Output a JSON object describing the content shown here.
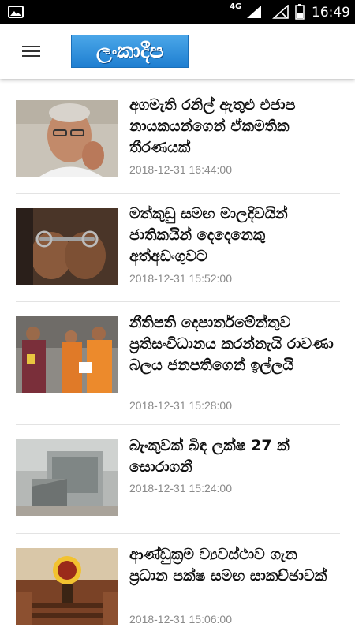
{
  "status_bar": {
    "network": "4G",
    "time": "16:49",
    "icons": [
      "photo-icon",
      "signal-icon",
      "signal-empty-icon",
      "battery-icon"
    ]
  },
  "app_bar": {
    "logo_text": "ලංකාදීප",
    "menu_icon": "hamburger-icon"
  },
  "articles": [
    {
      "title": "අගමැති රනිල් ඇතුළු එජාප නායකයන්ගෙන් ඒකමතික තීරණයක්",
      "date": "2018-12-31 16:44:00"
    },
    {
      "title": "මත්කුඩු සමඟ මාලදිවයින් ජාතිකයින් දෙදෙනෙකු අත්අඩංගුවට",
      "date": "2018-12-31 15:52:00"
    },
    {
      "title": "නීතිපති දෙපාර්තමේන්තුව ප්‍රතිසංවිධානය කරන්නැයි රාවණා බලය ජනපතිගෙන් ඉල්ලයි",
      "date": "2018-12-31 15:28:00"
    },
    {
      "title": "බැංකුවක් බිඳ ලක්ෂ 27 ක් සොරාගනී",
      "date": "2018-12-31 15:24:00"
    },
    {
      "title": "ආණ්ඩුක්‍රම ව්‍යවස්ථාව ගැන ප්‍රධාන පක්ෂ සමඟ සාකච්ඡාවක්",
      "date": "2018-12-31 15:06:00"
    }
  ],
  "colors": {
    "status_bar": "#000000",
    "logo_blue": "#1f7fd1",
    "date_grey": "#8a8a8a",
    "divider": "#e3e3e3"
  }
}
